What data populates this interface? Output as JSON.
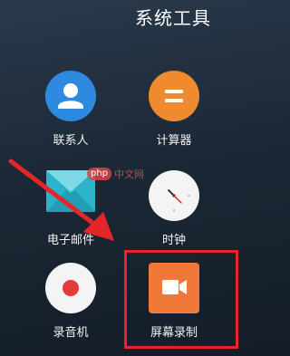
{
  "folder": {
    "title": "系统工具"
  },
  "apps": [
    {
      "label": "联系人",
      "icon": "contacts-icon"
    },
    {
      "label": "计算器",
      "icon": "calculator-icon"
    },
    {
      "label": "电子邮件",
      "icon": "email-icon"
    },
    {
      "label": "时钟",
      "icon": "clock-icon"
    },
    {
      "label": "录音机",
      "icon": "recorder-icon"
    },
    {
      "label": "屏幕录制",
      "icon": "screen-record-icon"
    }
  ],
  "watermark": {
    "logo": "php",
    "text": "中文网"
  },
  "colors": {
    "contacts": "#2d8ae0",
    "calculator": "#f08a2e",
    "screen_record": "#f0793a",
    "highlight": "#e4262b",
    "arrow": "#e4262b"
  }
}
